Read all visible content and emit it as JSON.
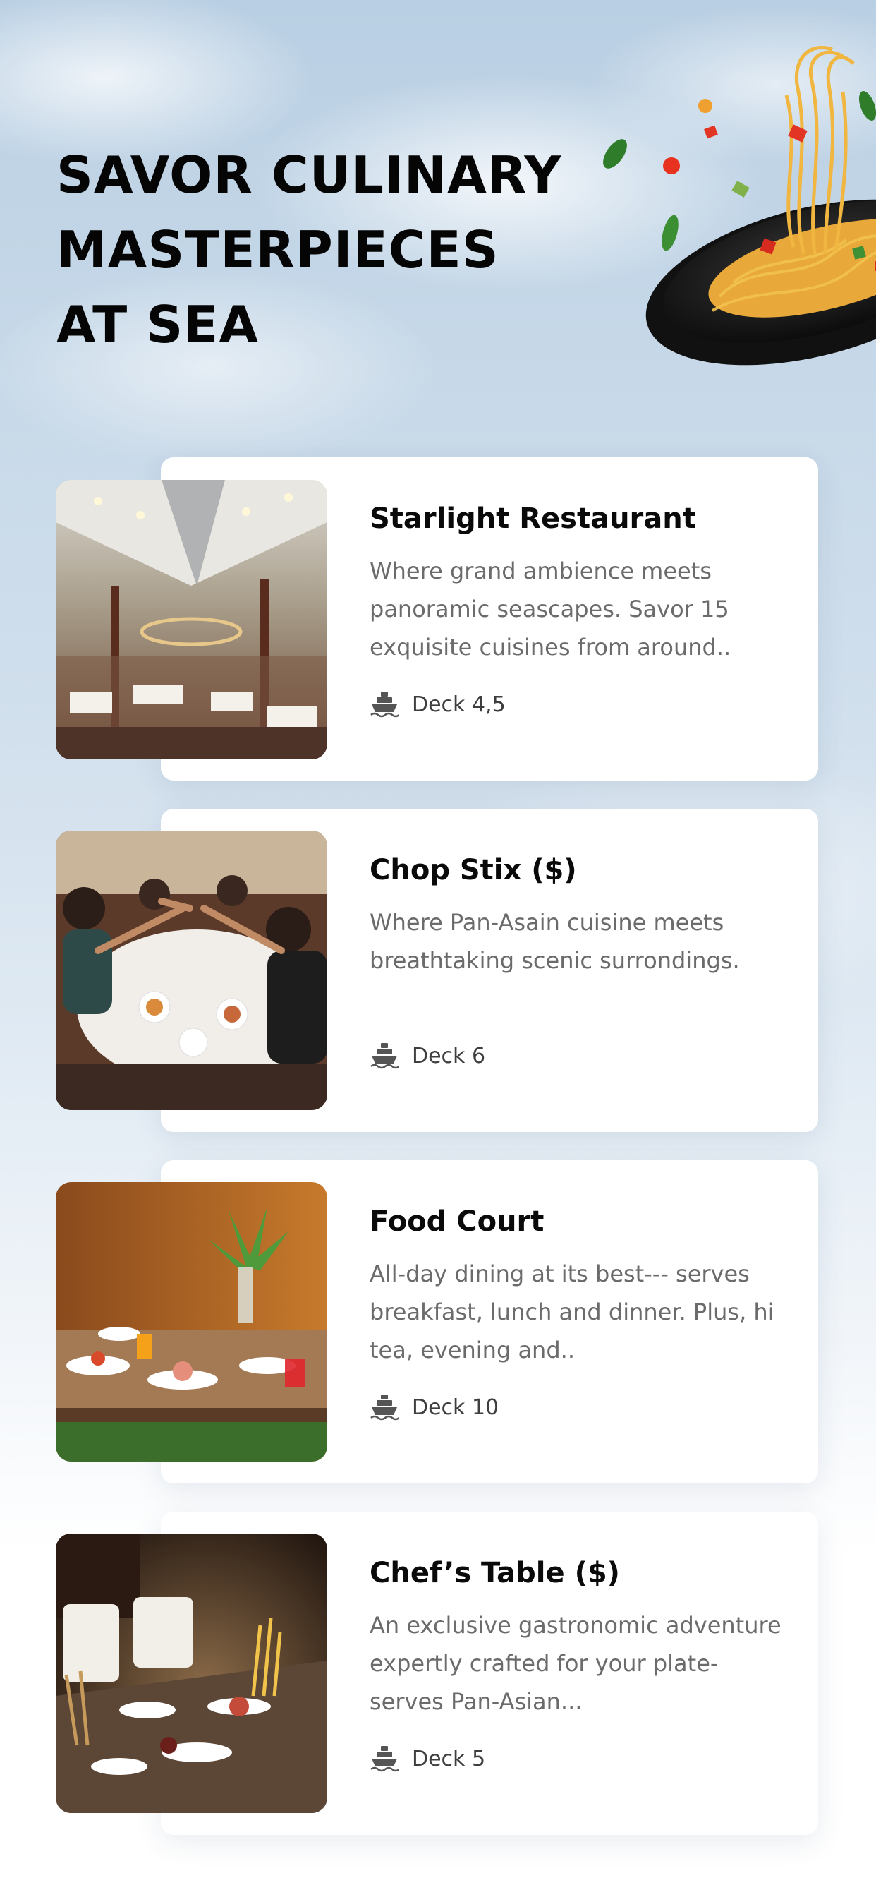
{
  "hero": {
    "title_lines": [
      "SAVOR CULINARY",
      "MASTERPIECES",
      "AT SEA"
    ]
  },
  "restaurants": [
    {
      "name": "Starlight Restaurant",
      "description": "Where grand ambience meets panoramic seascapes. Savor 15 exquisite cuisines from around..",
      "deck": "Deck 4,5"
    },
    {
      "name": "Chop Stix ($)",
      "description": "Where Pan-Asain cuisine meets breathtaking scenic surrondings.",
      "deck": "Deck 6"
    },
    {
      "name": "Food Court",
      "description": "All-day dining at its best--- serves breakfast, lunch and dinner. Plus, hi tea, evening and..",
      "deck": "Deck 10"
    },
    {
      "name": "Chef’s Table ($)",
      "description": "An exclusive gastronomic adventure expertly crafted for your plate- serves Pan-Asian...",
      "deck": "Deck 5"
    }
  ],
  "icons": {
    "deck": "ship-icon"
  },
  "colors": {
    "title": "#050505",
    "card_background": "#ffffff",
    "description_text": "#6b6b6b",
    "deck_text": "#3e3e3e"
  }
}
